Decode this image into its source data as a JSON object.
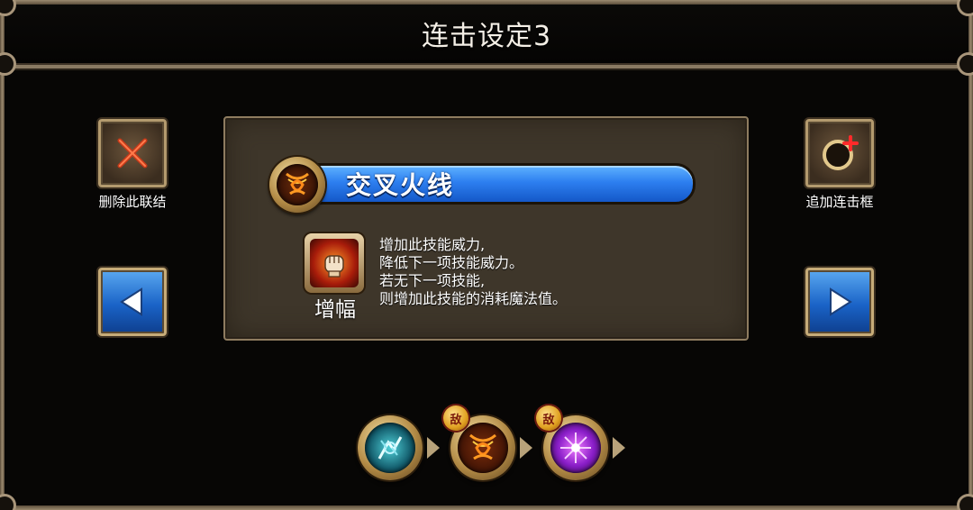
{
  "header": {
    "title": "连击设定3"
  },
  "left_actions": {
    "delete_label": "删除此联结"
  },
  "right_actions": {
    "add_label": "追加连击框"
  },
  "skill": {
    "name": "交叉火线",
    "effect_name": "增幅",
    "description": [
      "增加此技能威力,",
      "降低下一项技能威力。",
      "若无下一项技能,",
      "则增加此技能的消耗魔法值。"
    ]
  },
  "combo_chain": {
    "slot_badge_1": "敌",
    "slot_badge_2": "敌"
  },
  "colors": {
    "accent_blue": "#2d7ff0",
    "frame_gold": "#a8957a",
    "panel_bg": "#3e362a"
  }
}
